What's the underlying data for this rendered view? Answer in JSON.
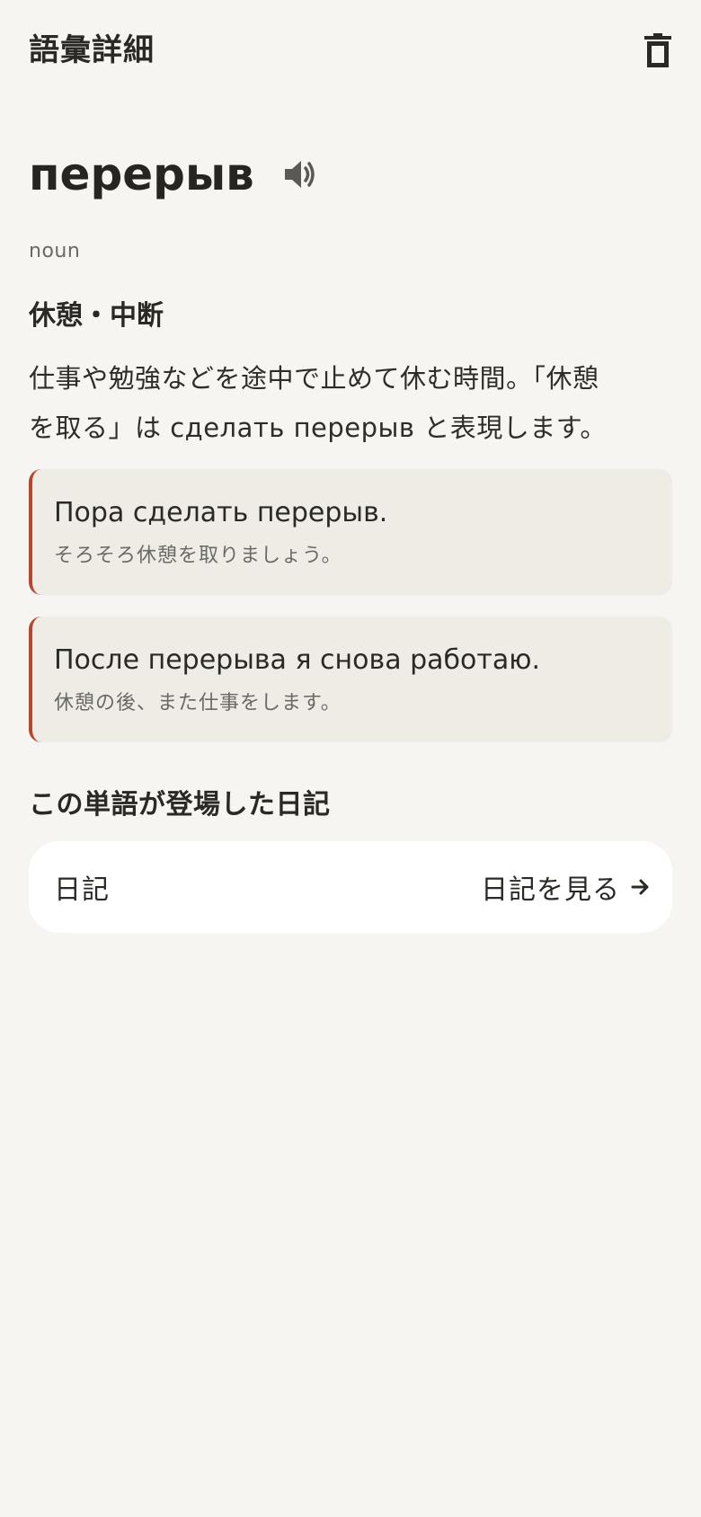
{
  "header": {
    "title": "語彙詳細",
    "delete_icon": "trash-icon"
  },
  "word": {
    "headword": "перерыв",
    "speaker_icon": "speaker-icon",
    "part_of_speech": "noun",
    "meaning": "休憩・中断",
    "explanation_line1": "仕事や勉強などを途中で止めて休む時間。「休憩",
    "explanation_line2": "を取る」は сделать перерыв と表現します。"
  },
  "examples": [
    {
      "ru": "Пора сделать перерыв.",
      "ja": "そろそろ休憩を取りましょう。"
    },
    {
      "ru": "После перерыва я снова работаю.",
      "ja": "休憩の後、また仕事をします。"
    }
  ],
  "diary_section": {
    "title": "この単語が登場した日記",
    "item_label": "日記",
    "link_label": "日記を見る",
    "link_icon": "arrow-right-icon"
  },
  "colors": {
    "background": "#f6f5f2",
    "card": "#efece6",
    "accent": "#b5472f",
    "text": "#262522",
    "muted": "#6b6964"
  }
}
